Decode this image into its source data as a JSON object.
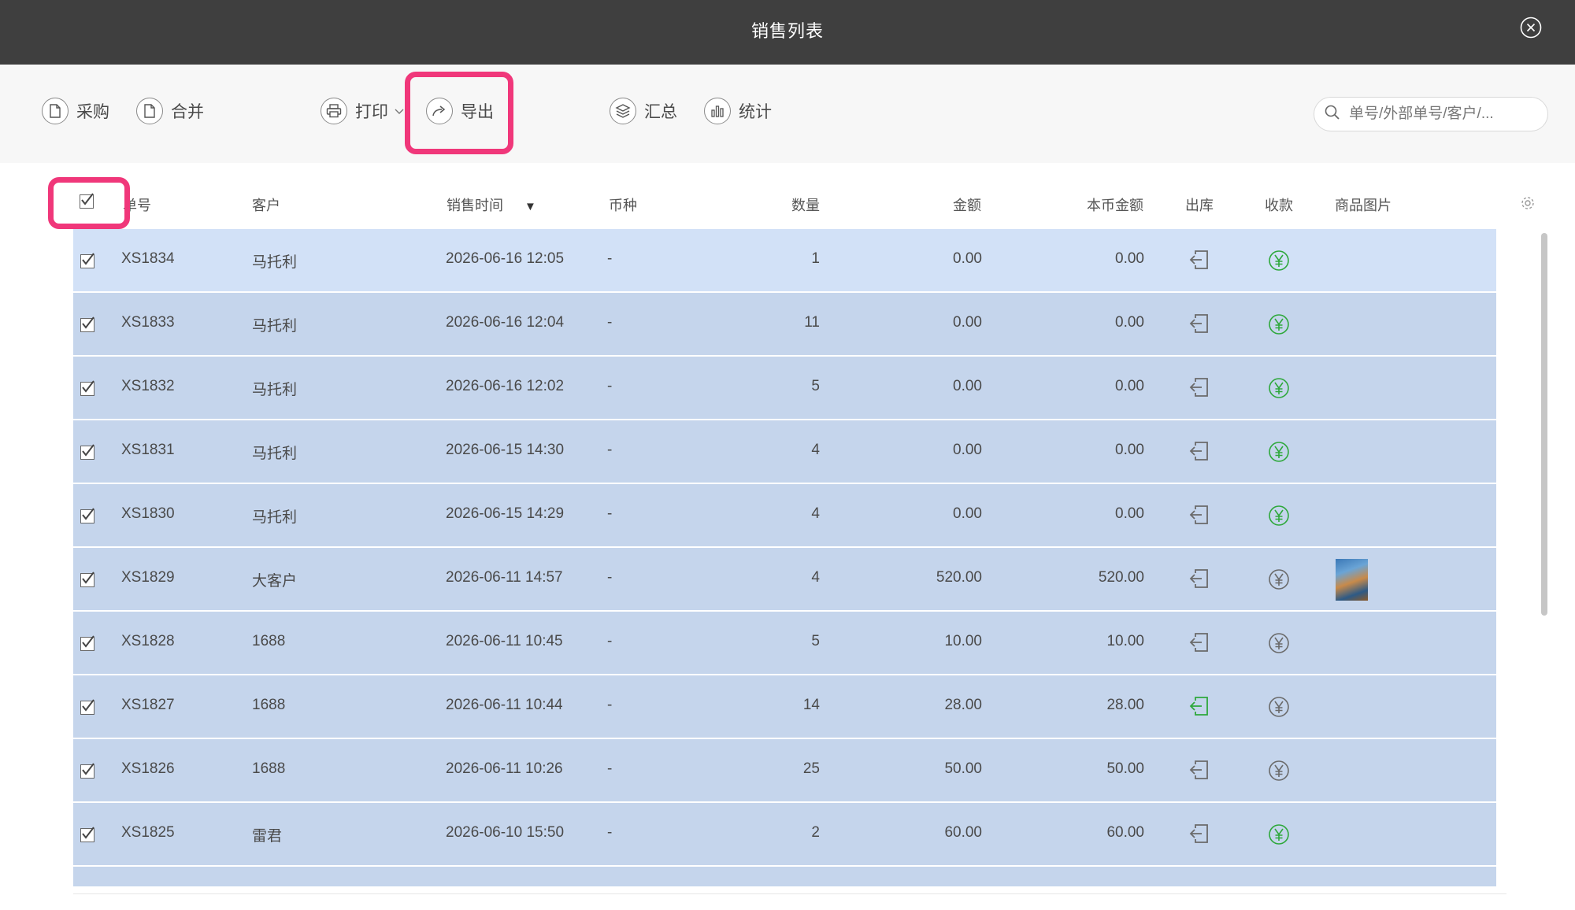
{
  "window": {
    "title": "销售列表",
    "close_icon": "close-circle-icon"
  },
  "toolbar": {
    "purchase": "采购",
    "merge": "合并",
    "print": "打印",
    "export": "导出",
    "summary": "汇总",
    "statistics": "统计",
    "search_placeholder": "单号/外部单号/客户/..."
  },
  "table": {
    "headers": {
      "order_no": "单号",
      "customer": "客户",
      "sale_time": "销售时间",
      "sort_indicator": "▼",
      "currency": "币种",
      "quantity": "数量",
      "amount": "金额",
      "local_amount": "本币金额",
      "outbound": "出库",
      "payment": "收款",
      "image": "商品图片"
    },
    "rows": [
      {
        "no": "XS1834",
        "customer": "马托利",
        "time": "2026-06-16 12:05",
        "currency": "-",
        "qty": "1",
        "amount": "0.00",
        "local": "0.00",
        "out_green": false,
        "pay_green": true,
        "has_image": false
      },
      {
        "no": "XS1833",
        "customer": "马托利",
        "time": "2026-06-16 12:04",
        "currency": "-",
        "qty": "11",
        "amount": "0.00",
        "local": "0.00",
        "out_green": false,
        "pay_green": true,
        "has_image": false
      },
      {
        "no": "XS1832",
        "customer": "马托利",
        "time": "2026-06-16 12:02",
        "currency": "-",
        "qty": "5",
        "amount": "0.00",
        "local": "0.00",
        "out_green": false,
        "pay_green": true,
        "has_image": false
      },
      {
        "no": "XS1831",
        "customer": "马托利",
        "time": "2026-06-15 14:30",
        "currency": "-",
        "qty": "4",
        "amount": "0.00",
        "local": "0.00",
        "out_green": false,
        "pay_green": true,
        "has_image": false
      },
      {
        "no": "XS1830",
        "customer": "马托利",
        "time": "2026-06-15 14:29",
        "currency": "-",
        "qty": "4",
        "amount": "0.00",
        "local": "0.00",
        "out_green": false,
        "pay_green": true,
        "has_image": false
      },
      {
        "no": "XS1829",
        "customer": "大客户",
        "time": "2026-06-11 14:57",
        "currency": "-",
        "qty": "4",
        "amount": "520.00",
        "local": "520.00",
        "out_green": false,
        "pay_green": false,
        "has_image": true
      },
      {
        "no": "XS1828",
        "customer": "1688",
        "time": "2026-06-11 10:45",
        "currency": "-",
        "qty": "5",
        "amount": "10.00",
        "local": "10.00",
        "out_green": false,
        "pay_green": false,
        "has_image": false
      },
      {
        "no": "XS1827",
        "customer": "1688",
        "time": "2026-06-11 10:44",
        "currency": "-",
        "qty": "14",
        "amount": "28.00",
        "local": "28.00",
        "out_green": true,
        "pay_green": false,
        "has_image": false
      },
      {
        "no": "XS1826",
        "customer": "1688",
        "time": "2026-06-11 10:26",
        "currency": "-",
        "qty": "25",
        "amount": "50.00",
        "local": "50.00",
        "out_green": false,
        "pay_green": false,
        "has_image": false
      },
      {
        "no": "XS1825",
        "customer": "雷君",
        "time": "2026-06-10 15:50",
        "currency": "-",
        "qty": "2",
        "amount": "60.00",
        "local": "60.00",
        "out_green": false,
        "pay_green": true,
        "has_image": false
      }
    ]
  },
  "colors": {
    "titlebar": "#3f3f3f",
    "row_bg": "#c5d5ec",
    "row_first_bg": "#d2e1f7",
    "green": "#2ea83b",
    "gray_icon": "#6a6a6a",
    "highlight": "#f0377a"
  }
}
